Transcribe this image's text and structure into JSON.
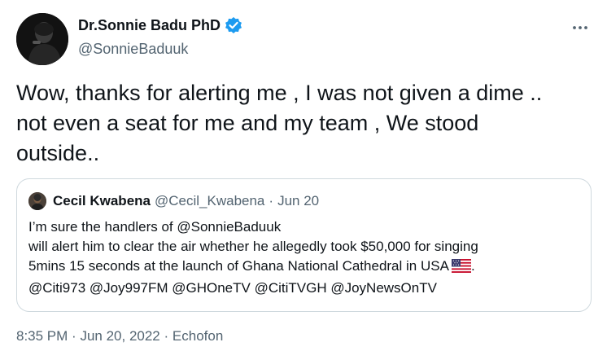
{
  "author": {
    "name": "Dr.Sonnie Badu PhD",
    "handle": "@SonnieBaduuk",
    "verified": true,
    "verified_color": "#1d9bf0"
  },
  "more_icon": "more-horizontal-icon",
  "tweet": {
    "text_lines": [
      "Wow, thanks for alerting me , I was not given a dime ..",
      "not even a seat for me and my team , We stood",
      "outside.."
    ]
  },
  "quote": {
    "name": "Cecil Kwabena",
    "handle": "@Cecil_Kwabena",
    "separator": "·",
    "date": "Jun 20",
    "lines": [
      "I’m sure the handlers of @SonnieBaduuk",
      "will alert him to clear the air whether he allegedly took $50,000 for singing",
      "5mins 15 seconds at the launch of Ghana National Cathedral in USA",
      "@Citi973 @Joy997FM @GHOneTV @CitiTVGH @JoyNewsOnTV"
    ],
    "line3_suffix": ".",
    "flag_icon": "us-flag-icon"
  },
  "meta": {
    "time": "8:35 PM",
    "sep1": "·",
    "date": "Jun 20, 2022",
    "sep2": "·",
    "source": "Echofon"
  },
  "colors": {
    "text": "#0f1419",
    "secondary": "#536471",
    "border": "#cfd9de"
  }
}
